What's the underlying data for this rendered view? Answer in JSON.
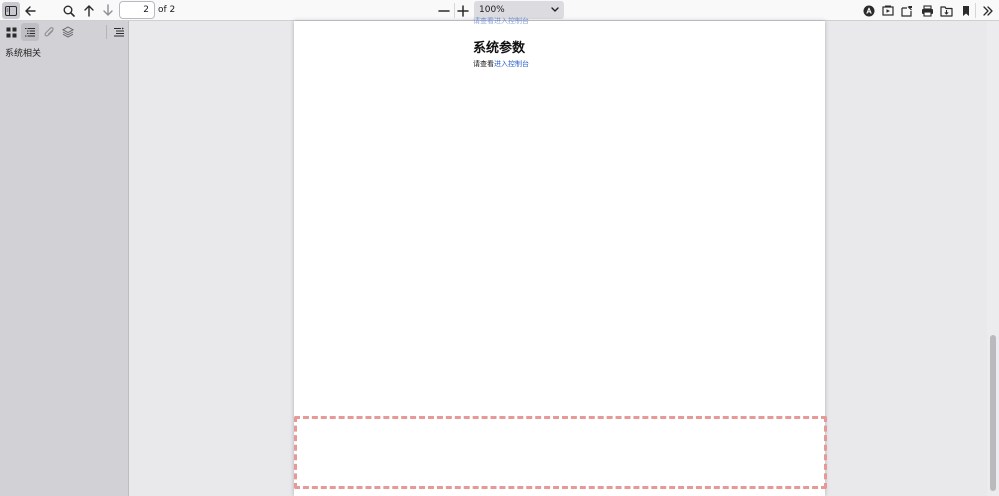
{
  "toolbar": {
    "page_number": "2",
    "page_count_label": "of 2",
    "zoom_value": "100%",
    "icons": [
      "sidebar-toggle-icon",
      "back-arrow-icon",
      "search-icon",
      "arrow-up-icon",
      "arrow-down-icon",
      "zoom-out-icon",
      "zoom-in-icon",
      "chevron-down-icon",
      "text-annotate-icon",
      "presentation-icon",
      "edit-icon",
      "print-icon",
      "folder-icon",
      "bookmark-icon",
      "more-tools-icon"
    ]
  },
  "sidebar": {
    "tab_icons": [
      "thumbnails-icon",
      "outline-icon",
      "attachments-icon",
      "layers-icon",
      "current-outline-icon"
    ],
    "outline": [
      {
        "label": "系统相关"
      }
    ]
  },
  "document": {
    "clipped_line": "请查看进入控制台",
    "heading": "系统参数",
    "para_prefix": "请查看",
    "para_link": "进入控制台"
  },
  "colors": {
    "link": "#2a5fcf",
    "signature_border": "#e59a98",
    "toolbar_bg": "#f9f9fa",
    "sidebar_bg": "#d2d2d6",
    "viewer_bg": "#e9e9ec"
  }
}
